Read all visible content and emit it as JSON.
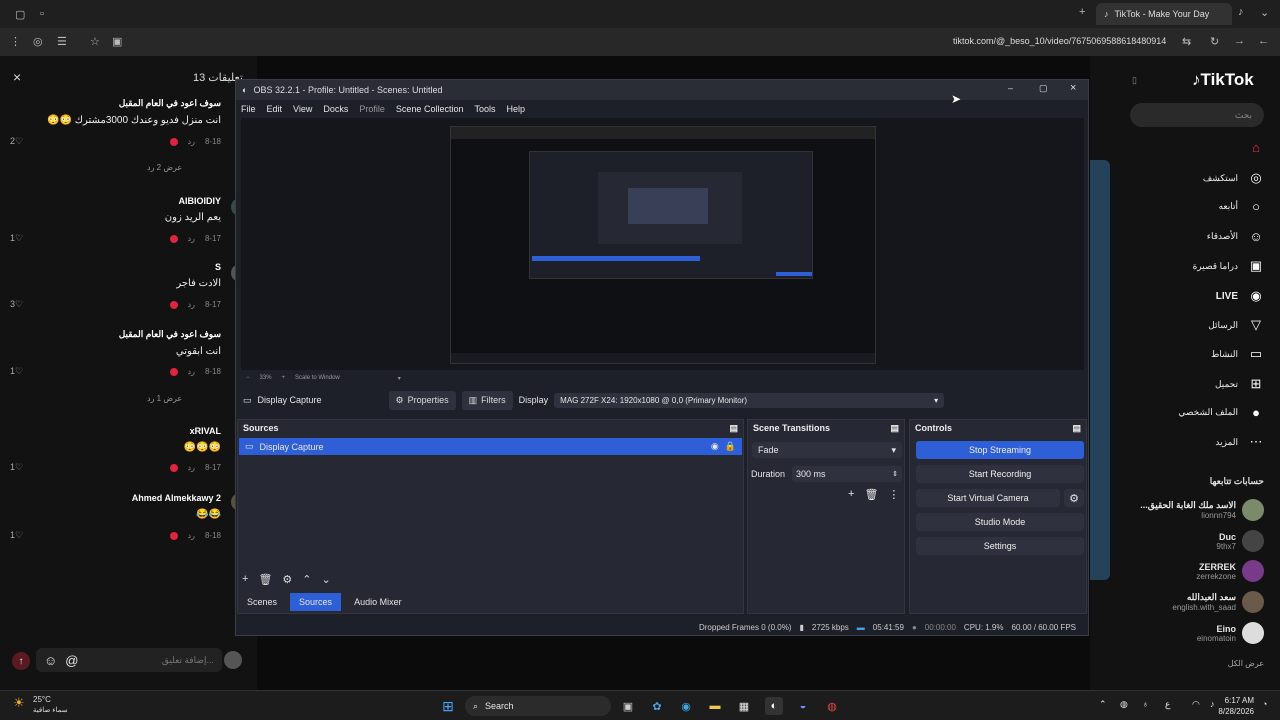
{
  "browser": {
    "tab_title": "TikTok - Make Your Day",
    "url": "tiktok.com/@_beso_10/video/7675069588618480914"
  },
  "comments": {
    "header": "13 تعليقات",
    "items": [
      {
        "name": "سوف اعود في العام المقبل",
        "text": "انت منزل فديو وعندك 3000مشترك 😳😳",
        "date": "8-18",
        "reply": "رد",
        "likes": "2",
        "more": "عرض 2 رد"
      },
      {
        "name": "AIBIOIDIY",
        "text": "يعم الريد زون",
        "date": "8-17",
        "reply": "رد",
        "likes": "1",
        "more": ""
      },
      {
        "name": "S",
        "text": "الادت فاجر",
        "date": "8-17",
        "reply": "رد",
        "likes": "3",
        "more": ""
      },
      {
        "name": "سوف اعود في العام المقبل",
        "text": "انت ابقوتي",
        "date": "8-18",
        "reply": "رد",
        "likes": "1",
        "more": "عرض 1 رد"
      },
      {
        "name": "xRIVAL",
        "text": "😳😳😳",
        "date": "8-17",
        "reply": "رد",
        "likes": "1",
        "more": ""
      },
      {
        "name": "Ahmed Almekkawy 2",
        "text": "😂😂",
        "date": "8-18",
        "reply": "رد",
        "likes": "1",
        "more": ""
      }
    ],
    "input_placeholder": "إضافة تعليق..."
  },
  "tiktok": {
    "logo": "TikTok",
    "search_placeholder": "بحث",
    "nav": [
      {
        "label": "",
        "icon": "home-icon"
      },
      {
        "label": "استكشف",
        "icon": "compass-icon"
      },
      {
        "label": "أتابعه",
        "icon": "following-icon"
      },
      {
        "label": "الأصدقاء",
        "icon": "friends-icon"
      },
      {
        "label": "دراما قصيرة",
        "icon": "drama-icon"
      },
      {
        "label": "LIVE",
        "icon": "live-icon"
      },
      {
        "label": "الرسائل",
        "icon": "messages-icon"
      },
      {
        "label": "النشاط",
        "icon": "activity-icon"
      },
      {
        "label": "تحميل",
        "icon": "upload-icon"
      },
      {
        "label": "الملف الشخصي",
        "icon": "profile-icon"
      },
      {
        "label": "المزيد",
        "icon": "more-icon"
      }
    ],
    "following_header": "حسابات تتابعها",
    "following": [
      {
        "name": "الاسد ملك الغابة الحقيق...",
        "handle": "lionnn794"
      },
      {
        "name": "Duc",
        "handle": "9thx7"
      },
      {
        "name": "ZERREK",
        "handle": "zerrekzone"
      },
      {
        "name": "سعد العبدالله",
        "handle": "english.with_saad"
      },
      {
        "name": "Eino",
        "handle": "einomatoin"
      }
    ],
    "show_all": "عرض الكل"
  },
  "obs": {
    "title": "OBS 32.2.1 - Profile: Untitled - Scenes: Untitled",
    "menu": [
      "File",
      "Edit",
      "View",
      "Docks",
      "Profile",
      "Scene Collection",
      "Tools",
      "Help"
    ],
    "zoom": "33%",
    "scale": "Scale to Window",
    "source_name": "Display Capture",
    "properties": "Properties",
    "filters": "Filters",
    "display_label": "Display",
    "display_value": "MAG 272F X24: 1920x1080 @ 0,0 (Primary Monitor)",
    "sources_header": "Sources",
    "sources": [
      "Display Capture"
    ],
    "transitions_header": "Scene Transitions",
    "transition": "Fade",
    "duration_label": "Duration",
    "duration": "300 ms",
    "controls_header": "Controls",
    "controls": [
      "Stop Streaming",
      "Start Recording",
      "Start Virtual Camera",
      "Studio Mode",
      "Settings"
    ],
    "tabs": [
      "Scenes",
      "Sources",
      "Audio Mixer"
    ],
    "status": {
      "dropped": "Dropped Frames 0 (0.0%)",
      "kbps": "2725 kbps",
      "stream_time": "05:41:59",
      "rec_time": "00:00:00",
      "cpu": "CPU: 1.9%",
      "fps": "60.00 / 60.00 FPS"
    }
  },
  "taskbar": {
    "weather_temp": "25°C",
    "weather_desc": "سماء صافية",
    "search": "Search",
    "time": "6:17 AM",
    "date": "8/28/2026"
  },
  "colors": {
    "accent": "#2f5fd6",
    "tiktok_red": "#fe2c55"
  }
}
